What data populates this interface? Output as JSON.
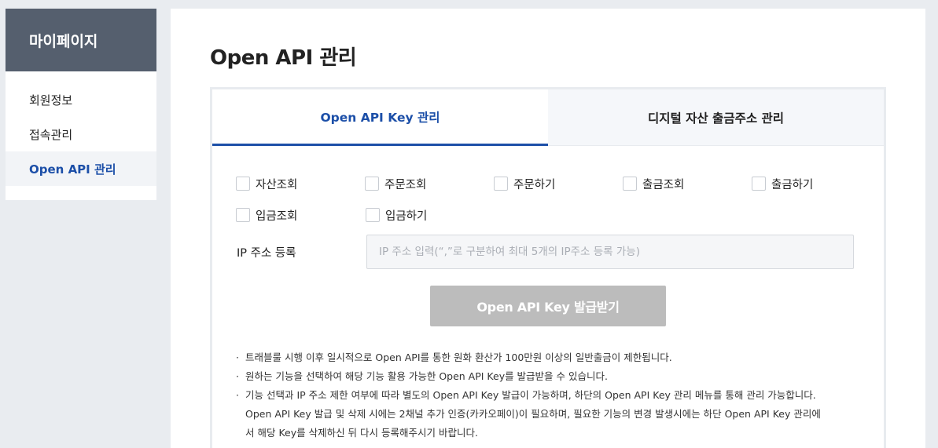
{
  "sidebar": {
    "title": "마이페이지",
    "items": [
      {
        "label": "회원정보"
      },
      {
        "label": "접속관리"
      },
      {
        "label": "Open API 관리"
      }
    ],
    "active_index": 2
  },
  "main": {
    "title": "Open API 관리",
    "tabs": [
      {
        "label": "Open API Key 관리"
      },
      {
        "label": "디지털 자산 출금주소 관리"
      }
    ],
    "active_tab": 0,
    "permissions": [
      {
        "label": "자산조회",
        "checked": false
      },
      {
        "label": "주문조회",
        "checked": false
      },
      {
        "label": "주문하기",
        "checked": false
      },
      {
        "label": "출금조회",
        "checked": false
      },
      {
        "label": "출금하기",
        "checked": false
      },
      {
        "label": "입금조회",
        "checked": false
      },
      {
        "label": "입금하기",
        "checked": false
      }
    ],
    "ip": {
      "label": "IP 주소 등록",
      "value": "",
      "placeholder": "IP 주소 입력(“,”로 구분하여 최대 5개의 IP주소 등록 가능)"
    },
    "issue_button": "Open API Key 발급받기",
    "notes": [
      {
        "lines": [
          "트래블룰 시행 이후 일시적으로 Open API를 통한 원화 환산가 100만원 이상의 일반출금이 제한됩니다."
        ]
      },
      {
        "lines": [
          "원하는 기능을 선택하여 해당 기능 활용 가능한 Open API Key를 발급받을 수 있습니다."
        ]
      },
      {
        "lines": [
          "기능 선택과 IP 주소 제한 여부에 따라 별도의 Open API Key 발급이 가능하며, 하단의 Open API Key 관리 메뉴를 통해 관리 가능합니다.",
          "Open API Key 발급 및 삭제 시에는 2채널 추가 인증(카카오페이)이 필요하며, 필요한 기능의 변경 발생시에는 하단 Open API Key 관리에",
          "서 해당 Key를 삭제하신 뒤 다시 등록해주시기 바랍니다."
        ]
      }
    ],
    "bullet": "·"
  },
  "colors": {
    "accent": "#1c4fa8",
    "sidebar_header": "#555f6e",
    "background": "#e9ecf0",
    "button_disabled": "#bcbcbc"
  }
}
